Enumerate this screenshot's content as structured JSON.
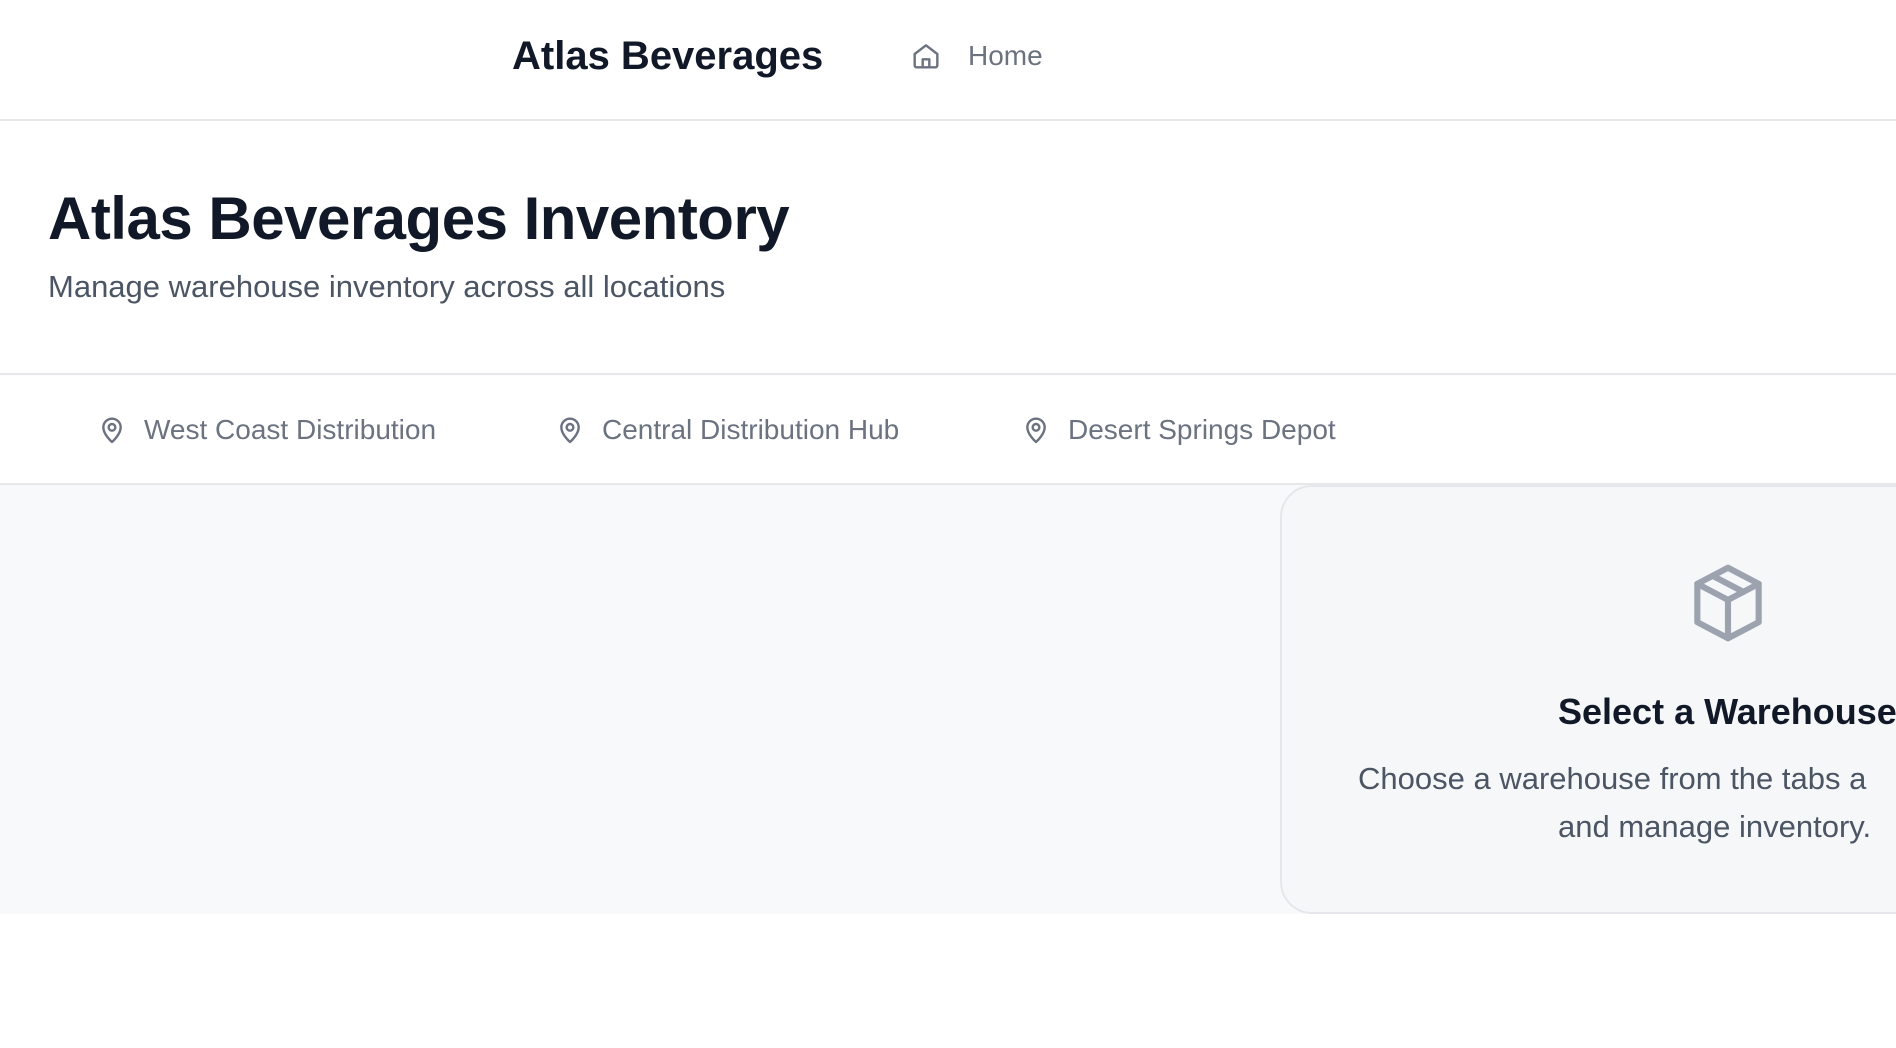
{
  "topbar": {
    "brand": "Atlas Beverages",
    "nav": [
      {
        "label": "Home",
        "icon": "home-icon"
      }
    ]
  },
  "header": {
    "title": "Atlas Beverages Inventory",
    "subtitle": "Manage warehouse inventory across all locations"
  },
  "tabs": [
    {
      "label": "West Coast Distribution",
      "icon": "map-pin-icon"
    },
    {
      "label": "Central Distribution Hub",
      "icon": "map-pin-icon"
    },
    {
      "label": "Desert Springs Depot",
      "icon": "map-pin-icon"
    }
  ],
  "empty_state": {
    "icon": "package-icon",
    "title": "Select a Warehouse",
    "description_line1": "Choose a warehouse from the tabs a",
    "description_line2": "and manage inventory."
  },
  "colors": {
    "text_primary": "#111827",
    "text_secondary": "#4b5563",
    "text_muted": "#6b7280",
    "icon_muted": "#9ca3af",
    "border": "#e5e7eb",
    "surface": "#f8f9fa"
  }
}
